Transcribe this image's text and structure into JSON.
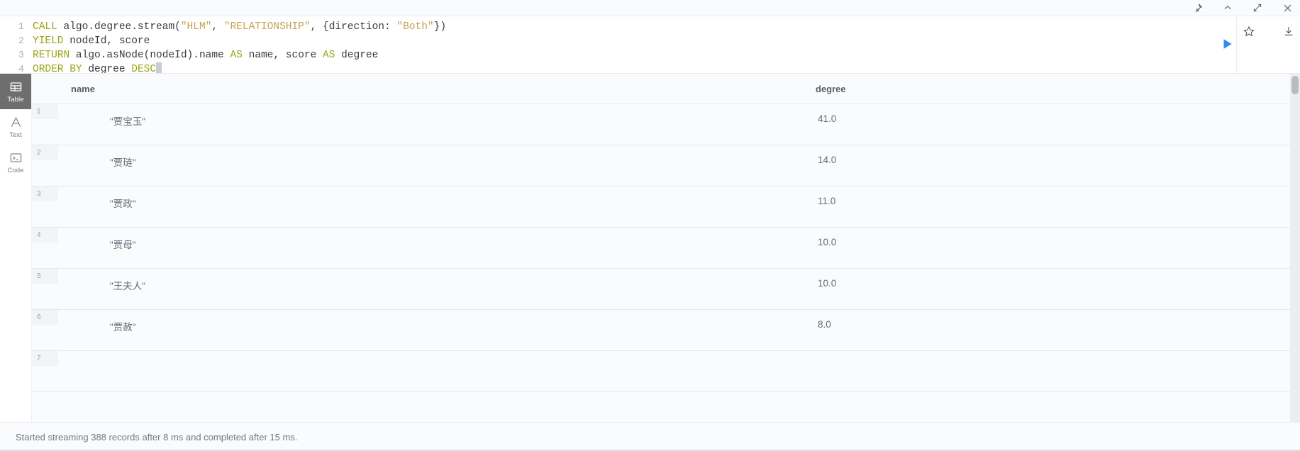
{
  "window_controls": [
    {
      "name": "pin-icon",
      "label": "Pin"
    },
    {
      "name": "collapse-icon",
      "label": "Collapse"
    },
    {
      "name": "expand-icon",
      "label": "Expand"
    },
    {
      "name": "close-icon",
      "label": "Close"
    }
  ],
  "editor": {
    "lines": [
      {
        "number": "1",
        "tokens": [
          {
            "t": "CALL ",
            "c": "kw"
          },
          {
            "t": "algo.degree.stream(",
            "c": "pl"
          },
          {
            "t": "\"HLM\"",
            "c": "str"
          },
          {
            "t": ", ",
            "c": "pl"
          },
          {
            "t": "\"RELATIONSHIP\"",
            "c": "str"
          },
          {
            "t": ", {direction: ",
            "c": "pl"
          },
          {
            "t": "\"Both\"",
            "c": "str"
          },
          {
            "t": "})",
            "c": "pl"
          }
        ]
      },
      {
        "number": "2",
        "tokens": [
          {
            "t": "YIELD ",
            "c": "kw"
          },
          {
            "t": "nodeId, score",
            "c": "pl"
          }
        ]
      },
      {
        "number": "3",
        "tokens": [
          {
            "t": "RETURN ",
            "c": "kw"
          },
          {
            "t": "algo.asNode(nodeId).name ",
            "c": "pl"
          },
          {
            "t": "AS ",
            "c": "kw"
          },
          {
            "t": "name, score ",
            "c": "pl"
          },
          {
            "t": "AS ",
            "c": "kw"
          },
          {
            "t": "degree",
            "c": "pl"
          }
        ]
      },
      {
        "number": "4",
        "tokens": [
          {
            "t": "ORDER BY ",
            "c": "kw"
          },
          {
            "t": "degree ",
            "c": "pl"
          },
          {
            "t": "DESC",
            "c": "kw"
          }
        ]
      }
    ],
    "full_query": "CALL algo.degree.stream(\"HLM\", \"RELATIONSHIP\", {direction: \"Both\"})\nYIELD nodeId, score\nRETURN algo.asNode(nodeId).name AS name, score AS degree\nORDER BY degree DESC",
    "run_label": "Run",
    "favorite_label": "Add to favorites",
    "download_label": "Download"
  },
  "view_modes": [
    {
      "label": "Table",
      "icon": "table-icon",
      "active": true
    },
    {
      "label": "Text",
      "icon": "text-icon",
      "active": false
    },
    {
      "label": "Code",
      "icon": "code-icon",
      "active": false
    }
  ],
  "results": {
    "columns": [
      "name",
      "degree"
    ],
    "rows": [
      {
        "index": "1",
        "name": "\"贾宝玉\"",
        "degree": "41.0"
      },
      {
        "index": "2",
        "name": "\"贾琏\"",
        "degree": "14.0"
      },
      {
        "index": "3",
        "name": "\"贾政\"",
        "degree": "11.0"
      },
      {
        "index": "4",
        "name": "\"贾母\"",
        "degree": "10.0"
      },
      {
        "index": "5",
        "name": "\"王夫人\"",
        "degree": "10.0"
      },
      {
        "index": "6",
        "name": "\"贾赦\"",
        "degree": "8.0"
      },
      {
        "index": "7",
        "name": "",
        "degree": ""
      }
    ]
  },
  "status": {
    "message": "Started streaming 388 records after 8 ms and completed after 15 ms."
  },
  "colors": {
    "accent_play": "#2f8eed",
    "keyword": "#9aa515",
    "string": "#c7a252",
    "plain": "#3c3c3c",
    "panel_bg": "#f9fbfd",
    "active_tab_bg": "#6e6e6e"
  },
  "chart_data": {
    "type": "table",
    "title": "Degree centrality results",
    "categories": [
      "\"贾宝玉\"",
      "\"贾琏\"",
      "\"贾政\"",
      "\"贾母\"",
      "\"王夫人\"",
      "\"贾赦\""
    ],
    "values": [
      41.0,
      14.0,
      11.0,
      10.0,
      10.0,
      8.0
    ],
    "xlabel": "name",
    "ylabel": "degree"
  }
}
